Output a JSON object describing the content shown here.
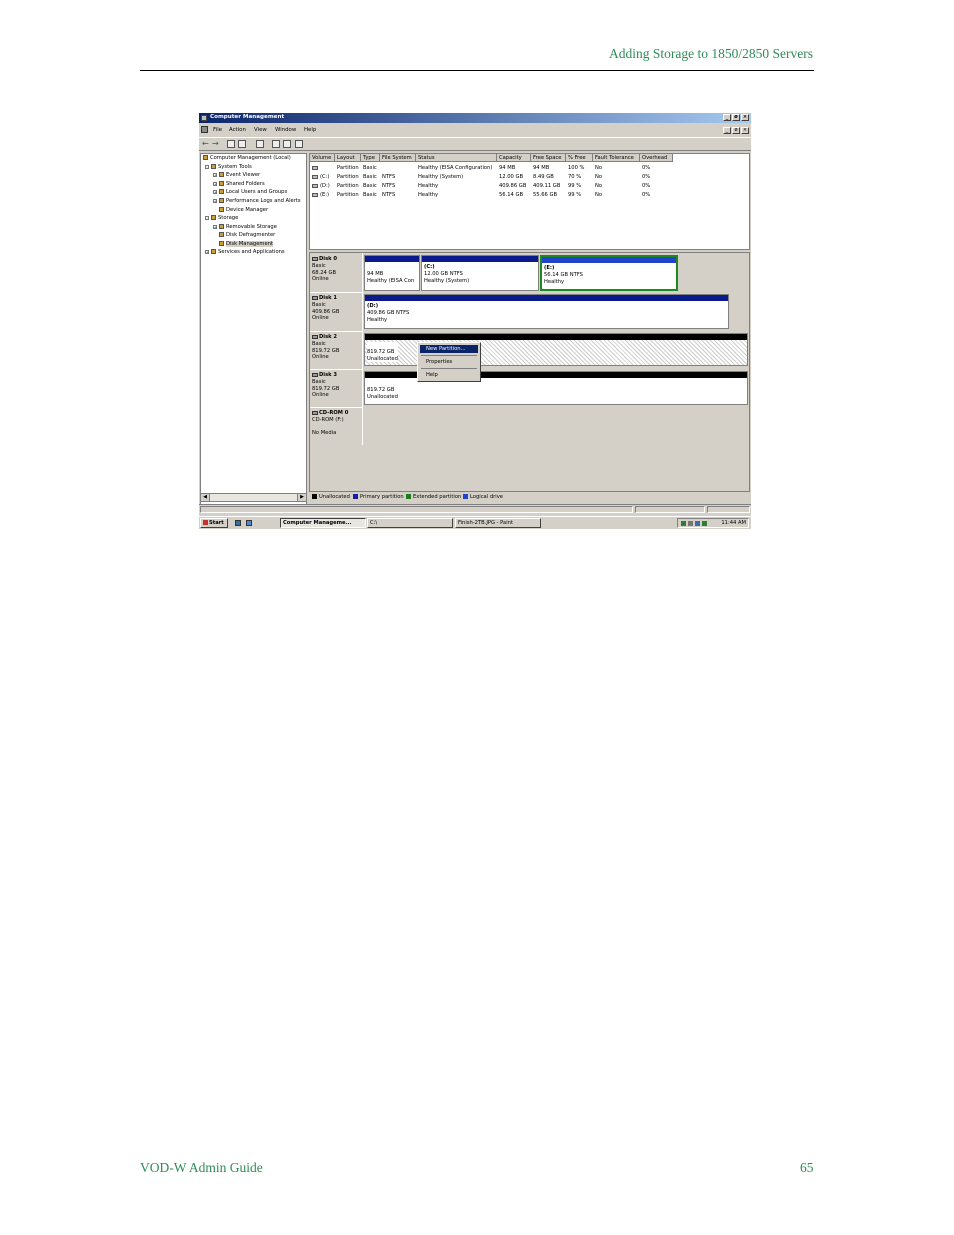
{
  "page": {
    "header": "Adding Storage to 1850/2850 Servers",
    "footer_left": "VOD-W Admin Guide",
    "footer_right": "65"
  },
  "window": {
    "title": "Computer Management",
    "controls": [
      "_",
      "ø",
      "×"
    ],
    "menu": [
      "File",
      "Action",
      "View",
      "Window",
      "Help"
    ]
  },
  "tree": {
    "items": [
      {
        "label": "Computer Management (Local)"
      },
      {
        "label": "System Tools"
      },
      {
        "label": "Event Viewer"
      },
      {
        "label": "Shared Folders"
      },
      {
        "label": "Local Users and Groups"
      },
      {
        "label": "Performance Logs and Alerts"
      },
      {
        "label": "Device Manager"
      },
      {
        "label": "Storage"
      },
      {
        "label": "Removable Storage"
      },
      {
        "label": "Disk Defragmenter"
      },
      {
        "label": "Disk Management"
      },
      {
        "label": "Services and Applications"
      }
    ]
  },
  "volumes": {
    "columns": [
      "Volume",
      "Layout",
      "Type",
      "File System",
      "Status",
      "Capacity",
      "Free Space",
      "% Free",
      "Fault Tolerance",
      "Overhead"
    ],
    "rows": [
      [
        "",
        "Partition",
        "Basic",
        "",
        "Healthy (EISA Configuration)",
        "94 MB",
        "94 MB",
        "100 %",
        "No",
        "0%"
      ],
      [
        "(C:)",
        "Partition",
        "Basic",
        "NTFS",
        "Healthy (System)",
        "12.00 GB",
        "8.49 GB",
        "70 %",
        "No",
        "0%"
      ],
      [
        "(D:)",
        "Partition",
        "Basic",
        "NTFS",
        "Healthy",
        "409.86 GB",
        "409.11 GB",
        "99 %",
        "No",
        "0%"
      ],
      [
        "(E:)",
        "Partition",
        "Basic",
        "NTFS",
        "Healthy",
        "56.14 GB",
        "55.66 GB",
        "99 %",
        "No",
        "0%"
      ]
    ]
  },
  "disks": {
    "disk0": {
      "name": "Disk 0",
      "type": "Basic",
      "size": "68.24 GB",
      "state": "Online",
      "p1": {
        "l1": "94 MB",
        "l2": "Healthy (EISA Con"
      },
      "p2": {
        "l0": "(C:)",
        "l1": "12.00 GB NTFS",
        "l2": "Healthy (System)"
      },
      "p3": {
        "l0": "(E:)",
        "l1": "56.14 GB NTFS",
        "l2": "Healthy"
      }
    },
    "disk1": {
      "name": "Disk 1",
      "type": "Basic",
      "size": "409.86 GB",
      "state": "Online",
      "p1": {
        "l0": "(D:)",
        "l1": "409.86 GB NTFS",
        "l2": "Healthy"
      }
    },
    "disk2": {
      "name": "Disk 2",
      "type": "Basic",
      "size": "819.72 GB",
      "state": "Online",
      "p1": {
        "l1": "819.72 GB",
        "l2": "Unallocated"
      }
    },
    "disk3": {
      "name": "Disk 3",
      "type": "Basic",
      "size": "819.72 GB",
      "state": "Online",
      "p1": {
        "l1": "819.72 GB",
        "l2": "Unallocated"
      }
    },
    "cdrom": {
      "name": "CD-ROM 0",
      "type": "CD-ROM (F:)",
      "state": "No Media"
    }
  },
  "context_menu": {
    "items": [
      "New Partition...",
      "Properties",
      "Help"
    ]
  },
  "legend": {
    "items": [
      {
        "label": "Unallocated",
        "color": "#000000"
      },
      {
        "label": "Primary partition",
        "color": "#1a1aa8"
      },
      {
        "label": "Extended partition",
        "color": "#1e7a1e"
      },
      {
        "label": "Logical drive",
        "color": "#2244cc"
      }
    ]
  },
  "taskbar": {
    "start": "Start",
    "tasks": [
      "Computer Manageme...",
      "C:\\",
      "Finish-2TB.JPG - Paint"
    ],
    "clock": "11:44 AM"
  },
  "colors": {
    "primary_bar": "#0a1a8a",
    "selected_border": "#1e8a1e",
    "unallocated_bar": "#000000"
  }
}
